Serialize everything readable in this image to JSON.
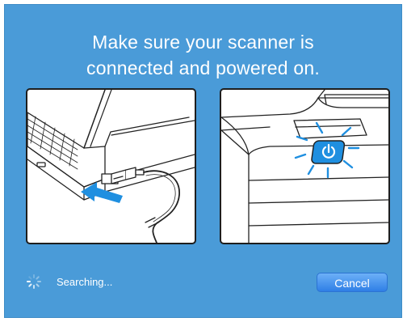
{
  "dialog": {
    "headline_line1": "Make sure your scanner is",
    "headline_line2": "connected and powered on.",
    "illustrations": {
      "left_icon": "laptop-usb-connection-illustration",
      "right_icon": "scanner-power-button-illustration"
    },
    "status": {
      "spinner_icon": "loading-spinner-icon",
      "text": "Searching..."
    },
    "cancel_label": "Cancel"
  },
  "colors": {
    "background": "#4a9bd8",
    "panel_border": "#1e1e1e",
    "accent_blue": "#1f8fe0",
    "button_blue": "#2f7fe6"
  }
}
